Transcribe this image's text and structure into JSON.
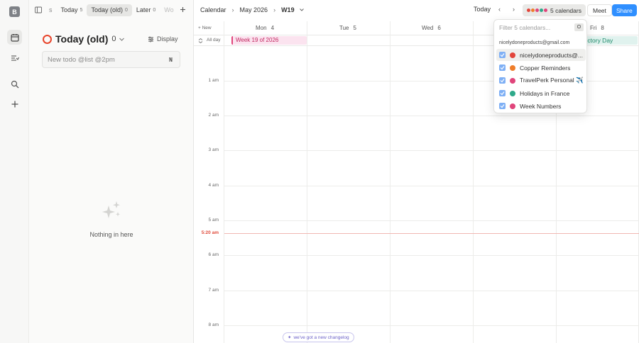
{
  "rail": {
    "avatar_letter": "B"
  },
  "tabs": [
    {
      "label": "s",
      "count": ""
    },
    {
      "label": "Today",
      "count": "5"
    },
    {
      "label": "Today (old)",
      "count": "0"
    },
    {
      "label": "Later",
      "count": "0"
    },
    {
      "label": "Wo",
      "count": ""
    }
  ],
  "panel": {
    "title": "Today (old)",
    "count": "0",
    "display_label": "Display",
    "new_todo_placeholder": "New todo @list @2pm",
    "new_todo_shortcut": "N",
    "empty_text": "Nothing in here"
  },
  "calendar": {
    "breadcrumb": {
      "root": "Calendar",
      "month": "May 2026",
      "week": "W19"
    },
    "today_label": "Today",
    "calendars_label": "5 calendars",
    "meet_label": "Meet",
    "share_label": "Share",
    "new_label": "New",
    "allday_label": "All day",
    "days": [
      {
        "name": "Mon",
        "num": "4"
      },
      {
        "name": "Tue",
        "num": "5"
      },
      {
        "name": "Wed",
        "num": "6"
      },
      {
        "name": "Fri",
        "num": "8"
      }
    ],
    "events": {
      "week": "Week 19 of 2026",
      "victory": "Victory Day"
    },
    "hours": [
      "1 am",
      "2 am",
      "3 am",
      "4 am",
      "5 am",
      "6 am",
      "7 am",
      "8 am"
    ],
    "now_label": "5:20 am",
    "changelog": "we've got a new changelog"
  },
  "dropdown": {
    "filter_placeholder": "Filter 5 calendars...",
    "filter_shortcut": "O",
    "account": "nicelydoneproducts@gmail.com",
    "items": [
      {
        "label": "nicelydoneproducts@...",
        "color": "#e2453b"
      },
      {
        "label": "Copper Reminders",
        "color": "#ef7d2a"
      },
      {
        "label": "TravelPerk Personal ✈️",
        "color": "#e0457b"
      },
      {
        "label": "Holidays in France",
        "color": "#2ea98a"
      },
      {
        "label": "Week Numbers",
        "color": "#e0457b"
      }
    ]
  },
  "colors": {
    "accent": "#2f8fff",
    "today_ring": "#e8452c",
    "now_line": "#e04a3a"
  }
}
